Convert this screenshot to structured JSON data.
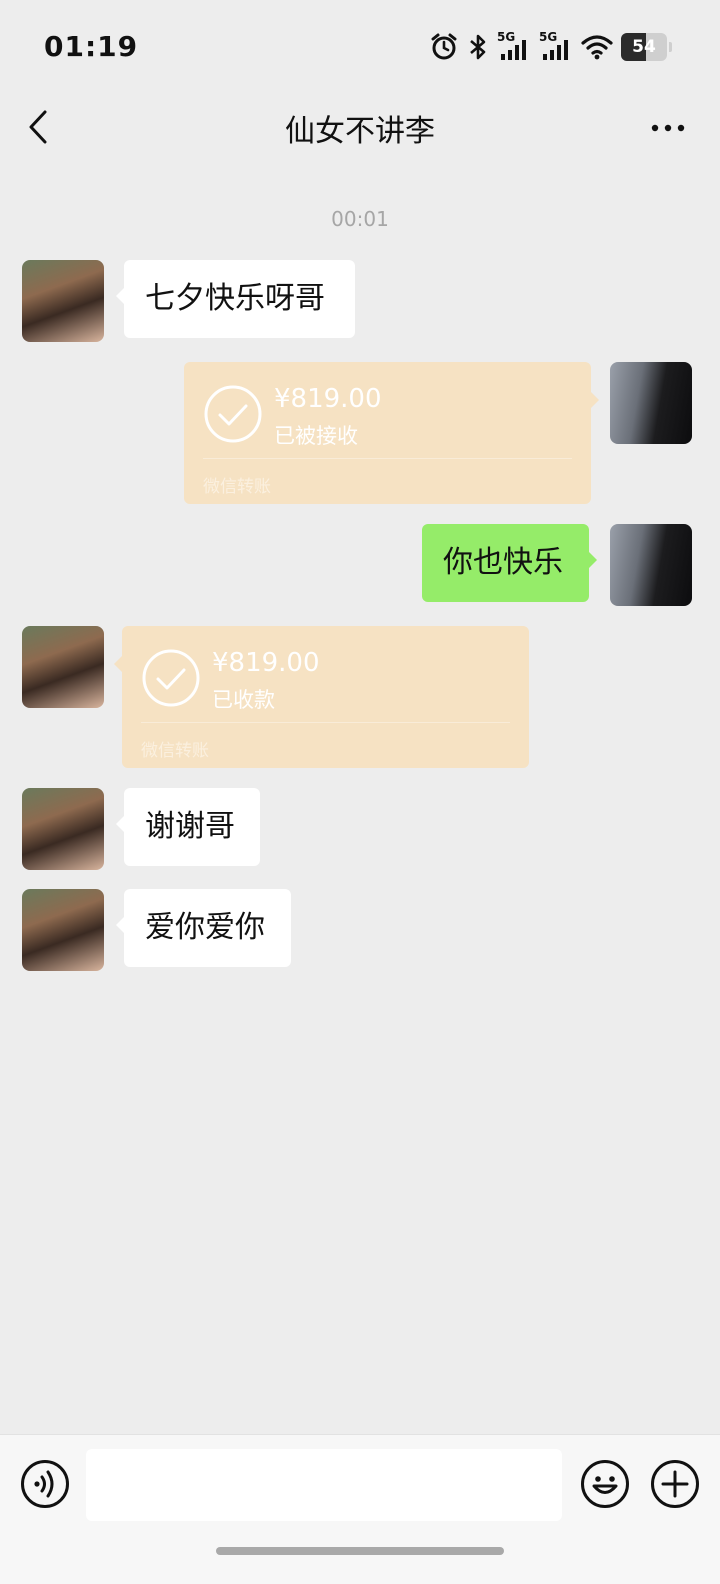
{
  "status_bar": {
    "time": "01:19",
    "network_1": "5G",
    "network_2": "5G",
    "battery_percent": 54,
    "battery_text": "54"
  },
  "nav": {
    "title": "仙女不讲李"
  },
  "chat": {
    "timestamp": "00:01",
    "messages": [
      {
        "from": "contact",
        "type": "text",
        "text": "七夕快乐呀哥"
      },
      {
        "from": "me",
        "type": "transfer",
        "amount": "¥819.00",
        "status": "已被接收",
        "label": "微信转账"
      },
      {
        "from": "me",
        "type": "text",
        "text": "你也快乐"
      },
      {
        "from": "contact",
        "type": "transfer",
        "amount": "¥819.00",
        "status": "已收款",
        "label": "微信转账"
      },
      {
        "from": "contact",
        "type": "text",
        "text": "谢谢哥"
      },
      {
        "from": "contact",
        "type": "text",
        "text": "爱你爱你"
      }
    ]
  },
  "input_bar": {
    "value": "",
    "placeholder": ""
  },
  "icons": {
    "back": "chevron-left-icon",
    "more": "more-icon",
    "voice": "voice-icon",
    "emoji": "emoji-icon",
    "plus": "plus-icon",
    "transfer_check": "check-circle-icon"
  },
  "colors": {
    "background": "#ededed",
    "bubble_incoming": "#ffffff",
    "bubble_outgoing": "#95ec69",
    "transfer_card": "#f6e2c3"
  }
}
